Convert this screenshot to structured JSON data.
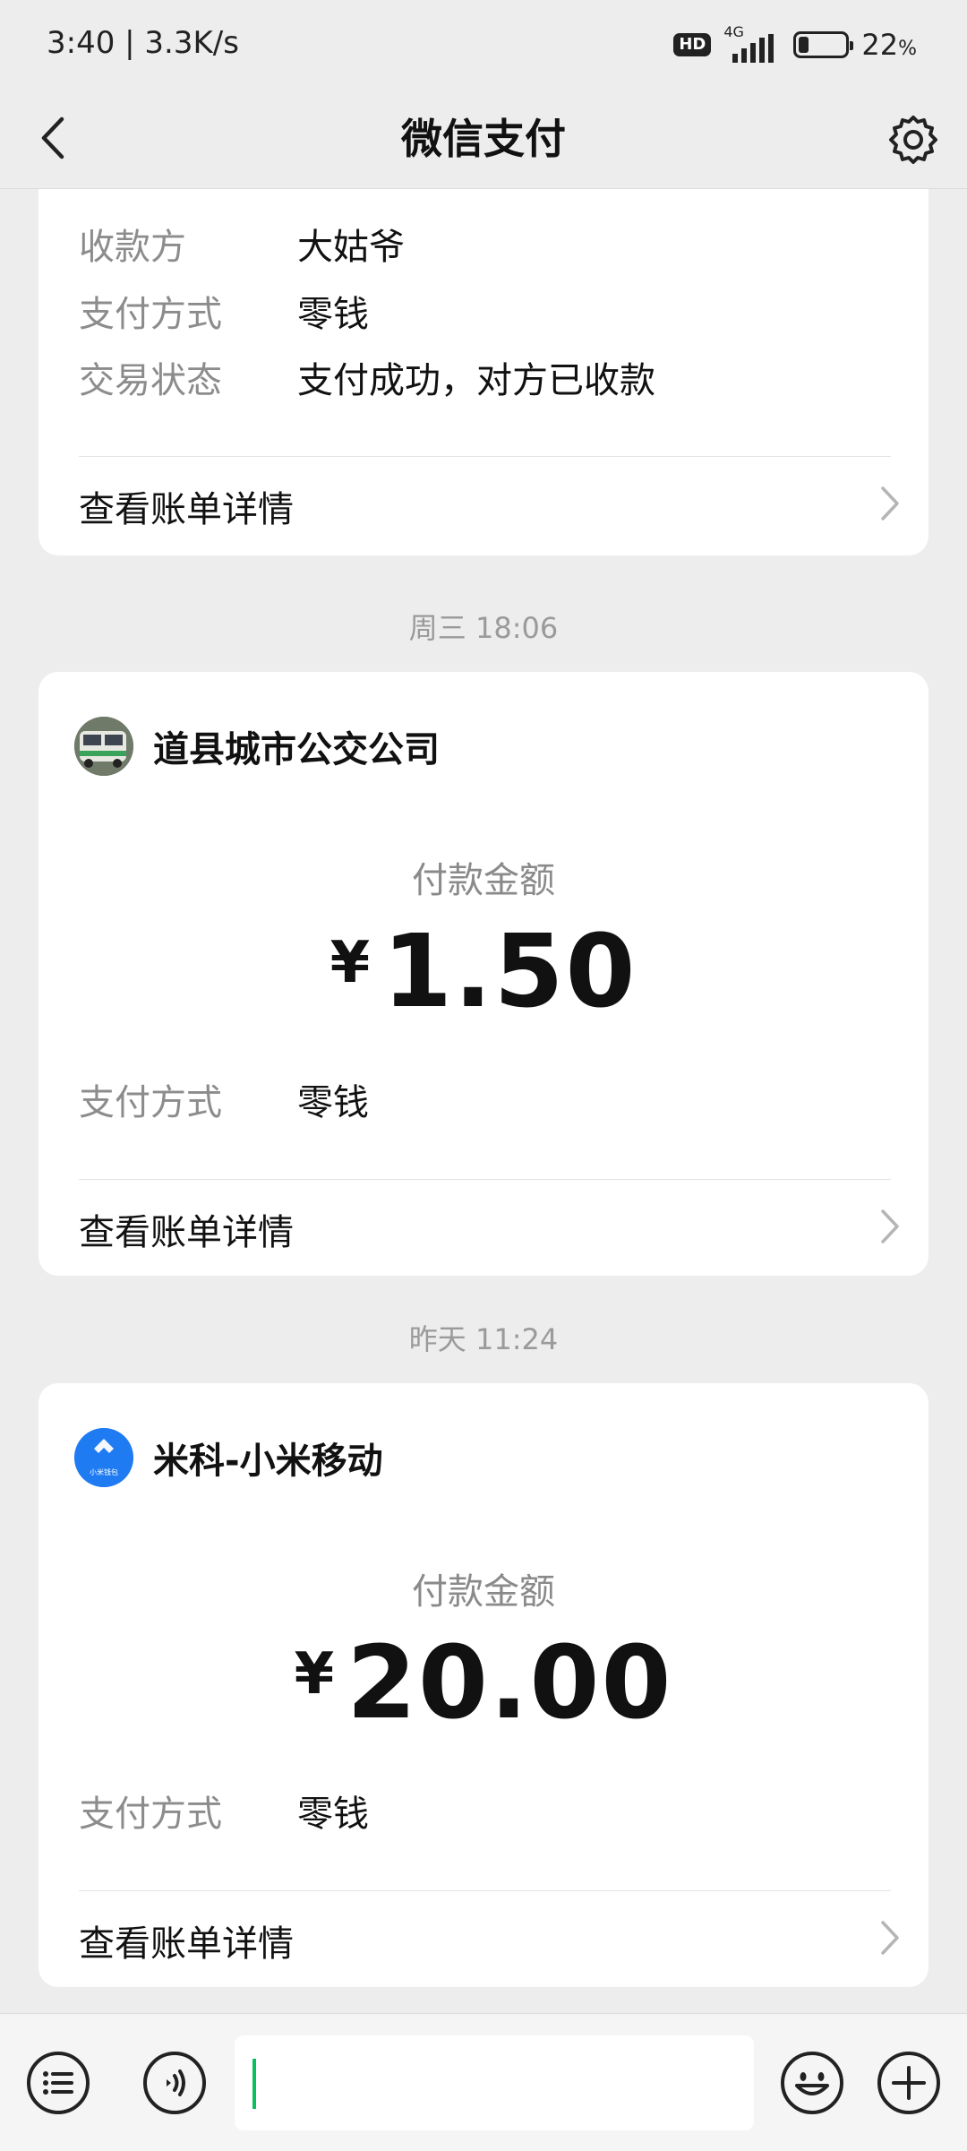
{
  "status_bar": {
    "time_speed": "3:40 | 3.3K/s",
    "hd": "HD",
    "network": "4G",
    "battery_percent": "22",
    "battery_unit": "%",
    "battery_level": 0.22
  },
  "nav": {
    "title": "微信支付",
    "back_icon": "chevron-left-icon",
    "settings_icon": "gear-icon"
  },
  "card1": {
    "rows": [
      {
        "key": "收款方",
        "value": "大姑爷"
      },
      {
        "key": "支付方式",
        "value": "零钱"
      },
      {
        "key": "交易状态",
        "value": "支付成功，对方已收款"
      }
    ],
    "detail_link": "查看账单详情"
  },
  "message2": {
    "timestamp": "周三 18:06",
    "merchant": "道县城市公交公司",
    "amount_label": "付款金额",
    "currency": "¥",
    "amount": "1.50",
    "pay_method_key": "支付方式",
    "pay_method_value": "零钱",
    "detail_link": "查看账单详情"
  },
  "message3": {
    "timestamp": "昨天 11:24",
    "merchant": "米科-小米移动",
    "avatar_text": "小米钱包",
    "amount_label": "付款金额",
    "currency": "¥",
    "amount": "20.00",
    "pay_method_key": "支付方式",
    "pay_method_value": "零钱",
    "detail_link": "查看账单详情"
  },
  "toolbar": {
    "menu_icon": "menu-list-icon",
    "voice_icon": "voice-icon",
    "emoji_icon": "emoji-icon",
    "add_icon": "plus-icon",
    "input_value": ""
  },
  "colors": {
    "background": "#ededed",
    "card": "#ffffff",
    "accent": "#07c160",
    "xiaomi_blue": "#1f7bf2"
  }
}
